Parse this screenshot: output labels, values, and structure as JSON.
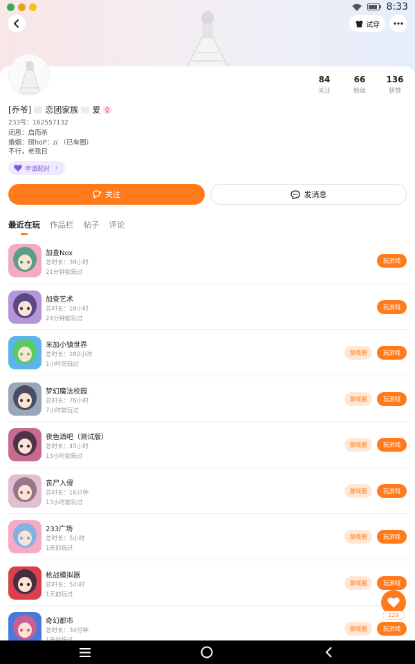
{
  "status_bar": {
    "time": "8:33"
  },
  "header": {
    "try_on_label": "试穿"
  },
  "profile": {
    "nickname_prefix": "[乔爷]",
    "nickname_mid": "恋团家族",
    "nickname_suffix": "爱",
    "uid": "233号：162557132",
    "bio_lines": [
      "闭思：启而杀",
      "婚姻：硕hoP：// （已有圈）",
      "不行，老我日"
    ],
    "cp_label": "申请配对",
    "stats": [
      {
        "value": "84",
        "label": "关注"
      },
      {
        "value": "66",
        "label": "粉丝"
      },
      {
        "value": "136",
        "label": "获赞"
      }
    ]
  },
  "actions": {
    "follow_label": "关注",
    "message_label": "发消息"
  },
  "tabs": [
    "最近在玩",
    "作品栏",
    "帖子",
    "评论"
  ],
  "games": [
    {
      "name": "加查Nox",
      "duration": "总时长：39小时",
      "last": "21分钟前玩过",
      "has_circle": false,
      "colors": [
        "#f3a9c8",
        "#3e9c7a"
      ]
    },
    {
      "name": "加查艺术",
      "duration": "总时长：16小时",
      "last": "24分钟前玩过",
      "has_circle": false,
      "colors": [
        "#b594d8",
        "#4a3a78"
      ]
    },
    {
      "name": "米加小镇世界",
      "duration": "总时长：282小时",
      "last": "1小时前玩过",
      "has_circle": true,
      "colors": [
        "#5bb5e8",
        "#5ccc4a"
      ]
    },
    {
      "name": "梦幻魔法校园",
      "duration": "总时长：76小时",
      "last": "7小时前玩过",
      "has_circle": true,
      "colors": [
        "#9aa7b8",
        "#3b3f4f"
      ]
    },
    {
      "name": "夜色酒吧（测试版）",
      "duration": "总时长：45小时",
      "last": "13小时前玩过",
      "has_circle": true,
      "colors": [
        "#c66a8f",
        "#3a2a3c"
      ]
    },
    {
      "name": "丧尸入侵",
      "duration": "总时长：16分钟",
      "last": "13小时前玩过",
      "has_circle": true,
      "colors": [
        "#e0c0d0",
        "#8a6a7a"
      ]
    },
    {
      "name": "233广场",
      "duration": "总时长：5小时",
      "last": "1天前玩过",
      "has_circle": true,
      "colors": [
        "#f7a9c8",
        "#6fb3e6"
      ]
    },
    {
      "name": "枪战模拟器",
      "duration": "总时长：5小时",
      "last": "1天前玩过",
      "has_circle": true,
      "colors": [
        "#d8404a",
        "#2a2a3e"
      ]
    },
    {
      "name": "奇幻都市",
      "duration": "总时长：34分钟",
      "last": "1天前玩过",
      "has_circle": true,
      "colors": [
        "#4a7ad8",
        "#e05a8a"
      ]
    }
  ],
  "buttons": {
    "circle_label": "游戏圈",
    "play_label": "玩游戏"
  },
  "fab": {
    "count": "129"
  },
  "accent_color": "#ff7a1a"
}
